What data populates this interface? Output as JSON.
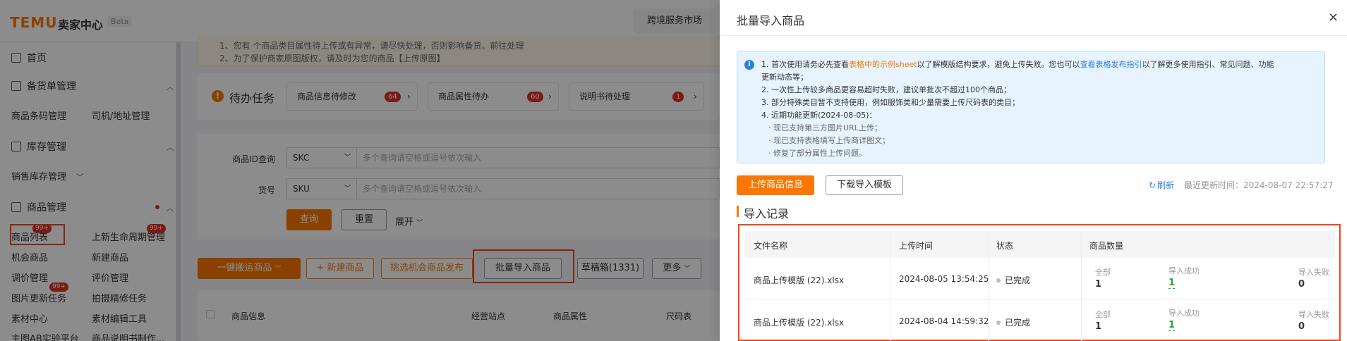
{
  "header": {
    "logo": "TEMU",
    "app_name": "卖家中心",
    "beta": "Beta",
    "market_button": "跨境服务市场"
  },
  "sidebar": {
    "home": "首页",
    "stock_mgmt": "备货单管理",
    "barcode": "商品条码管理",
    "driver_address": "司机/地址管理",
    "inventory_mgmt": "库存管理",
    "sales_inventory": "销售库存管理",
    "product_mgmt": "商品管理",
    "product_list": "商品列表",
    "product_list_badge": "99+",
    "lifecycle": "上新生命周期管理",
    "lifecycle_badge": "99+",
    "opportunity": "机会商品",
    "new_product": "新建商品",
    "price_adjust": "调价管理",
    "review_mgmt": "评价管理",
    "image_update": "图片更新任务",
    "image_update_badge": "99+",
    "shooting": "拍摄精修任务",
    "material_center": "素材中心",
    "material_edit": "素材编辑工具",
    "ab_test": "主图AB实验平台",
    "manual_make": "商品说明书制作..."
  },
  "notice": {
    "line1": "1、您有 个商品类目属性待上传或有异常，请尽快处理，否则影响备货。前往处理",
    "line2": "2、为了保护商家原图版权，请及时为您的商品【上传原图】"
  },
  "todo": {
    "title": "待办任务",
    "items": [
      {
        "label": "商品信息待修改",
        "count": "64"
      },
      {
        "label": "商品属性待办",
        "count": "60"
      },
      {
        "label": "说明书待处理",
        "count": "1"
      }
    ]
  },
  "search": {
    "id_label": "商品ID查询",
    "id_type": "SKC",
    "id_placeholder": "多个查询请空格或逗号依次输入",
    "code_label": "货号",
    "code_type": "SKU",
    "code_placeholder": "多个查询请空格或逗号依次输入",
    "query": "查询",
    "reset": "重置",
    "expand": "展开"
  },
  "actions": {
    "one_click": "一键搬运商品",
    "new_product": "+ 新建商品",
    "pick_opportunity": "挑选机会商品发布",
    "batch_import": "批量导入商品",
    "draft_box": "草稿箱(1331)",
    "more": "更多"
  },
  "table_header": {
    "product_info": "商品信息",
    "sites": "经营站点",
    "attributes": "商品属性",
    "size_chart": "尺码表"
  },
  "drawer": {
    "title": "批量导入商品",
    "close": "×",
    "info": {
      "l1_a": "1. 首次使用请务必先查看",
      "l1_link": "表格中的示例sheet",
      "l1_b": "以了解模版结构要求，避免上传失败。您也可以",
      "l1_link2": "查看表格发布指引",
      "l1_c": "以了解更多使用指引、常见问题、功能",
      "l1_d": "更新动态等；",
      "l2": "2. 一次性上传较多商品更容易超时失败，建议单批次不超过100个商品；",
      "l3": "3. 部分特殊类目暂不支持使用，例如服饰类和少量需要上传尺码表的类目；",
      "l4": "4. 近期功能更新(2024-08-05)：",
      "s1": "· 现已支持第三方图片URL上传；",
      "s2": "· 现已支持表格填写上传商详图文；",
      "s3": "· 修复了部分属性上传问题。"
    },
    "upload_btn": "上传商品信息",
    "download_btn": "下载导入模板",
    "refresh": "刷新",
    "last_update": "最近更新时间：2024-08-07 22:57:27",
    "records_title": "导入记录",
    "columns": {
      "file": "文件名称",
      "time": "上传时间",
      "status": "状态",
      "count": "商品数量"
    },
    "rows": [
      {
        "file": "商品上传模版 (22).xlsx",
        "time": "2024-08-05 13:54:25",
        "status": "已完成",
        "all_label": "全部",
        "all": "1",
        "ok_label": "导入成功",
        "ok": "1",
        "fail_label": "导入失败",
        "fail": "0"
      },
      {
        "file": "商品上传模版 (22).xlsx",
        "time": "2024-08-04 14:59:32",
        "status": "已完成",
        "all_label": "全部",
        "all": "1",
        "ok_label": "导入成功",
        "ok": "1",
        "fail_label": "导入失败",
        "fail": "0"
      }
    ]
  },
  "colors": {
    "brand": "#fb7701",
    "highlight": "#f2441d",
    "info_bg": "#e7f4ff",
    "success": "#22a83a"
  }
}
